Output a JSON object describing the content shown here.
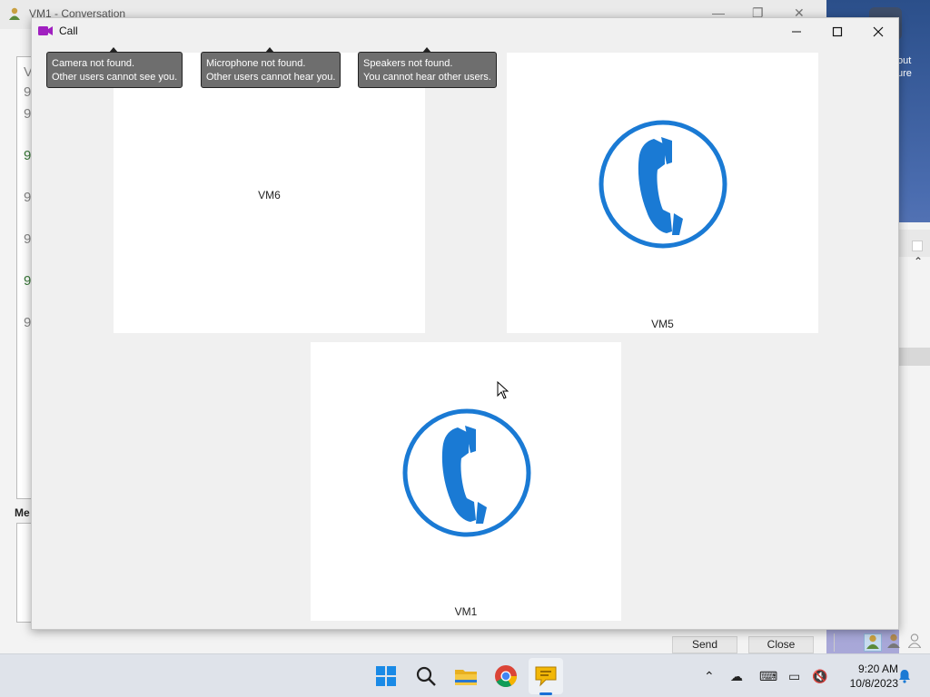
{
  "background_window": {
    "title": "VM1 - Conversation",
    "message_lines": [
      "V",
      "9",
      "9",
      "9",
      "9",
      "9",
      "9",
      "9"
    ],
    "message_label": "Me",
    "send_label": "Send",
    "close_label": "Close"
  },
  "desktop": {
    "wallpaper_text_1": "out",
    "wallpaper_text_2": "ure"
  },
  "call_window": {
    "title": "Call",
    "tooltips": [
      {
        "line1": "Camera not found.",
        "line2": "Other users cannot see you."
      },
      {
        "line1": "Microphone not found.",
        "line2": "Other users cannot hear you."
      },
      {
        "line1": "Speakers not found.",
        "line2": "You cannot hear other users."
      }
    ],
    "participants": [
      {
        "name": "VM6",
        "icon": "none"
      },
      {
        "name": "VM5",
        "icon": "phone-icon"
      },
      {
        "name": "VM1",
        "icon": "phone-icon"
      }
    ]
  },
  "taskbar": {
    "time": "9:20 AM",
    "date": "10/8/2023",
    "apps": [
      "windows-start-icon",
      "search-icon",
      "file-explorer-icon",
      "chrome-icon",
      "chat-app-icon"
    ]
  },
  "colors": {
    "accent": "#1a7ad4",
    "tooltip_bg": "#6e6e6e",
    "green_text": "#3a7a3a"
  }
}
